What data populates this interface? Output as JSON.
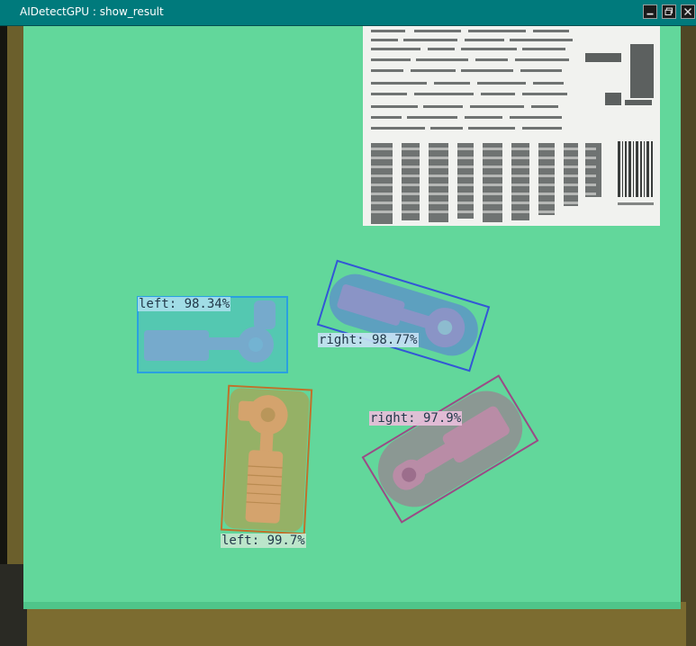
{
  "window": {
    "title": "AIDetectGPU : show_result",
    "controls": {
      "minimize_icon": "minimize-icon",
      "maximize_icon": "restore-icon",
      "close_icon": "close-icon"
    }
  },
  "detections": [
    {
      "label": "left: 98.34%",
      "class": "left",
      "confidence_pct": 98.34,
      "color": "#2aa0e0"
    },
    {
      "label": "right: 98.77%",
      "class": "right",
      "confidence_pct": 98.77,
      "color": "#3357d6"
    },
    {
      "label": "right: 97.9%",
      "class": "right",
      "confidence_pct": 97.9,
      "color": "#9b4b86"
    },
    {
      "label": "left: 99.7%",
      "class": "left",
      "confidence_pct": 99.7,
      "color": "#c0712a"
    }
  ],
  "colors": {
    "titlebar": "#007a7c",
    "board": "#62d79b",
    "label_area": "#f1f2ef"
  }
}
